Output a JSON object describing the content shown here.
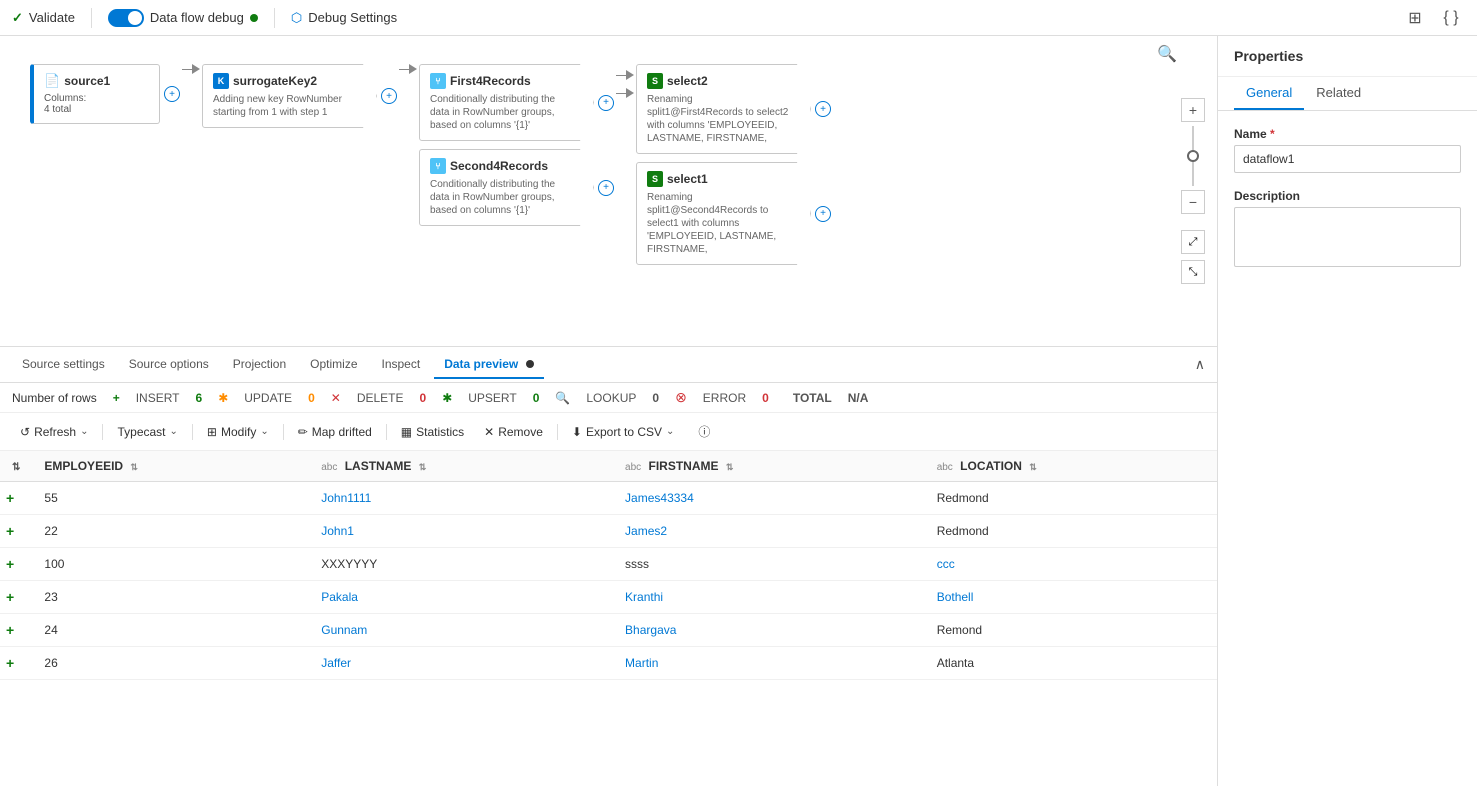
{
  "toolbar": {
    "validate_label": "Validate",
    "debug_label": "Data flow debug",
    "debug_settings_label": "Debug Settings"
  },
  "flow": {
    "nodes": [
      {
        "id": "source1",
        "title": "source1",
        "type": "source",
        "meta": "Columns:",
        "meta2": "4 total",
        "icon": "📄"
      },
      {
        "id": "surrogateKey2",
        "title": "surrogateKey2",
        "type": "transform",
        "desc": "Adding new key RowNumber starting from 1 with step 1"
      },
      {
        "id": "First4Records",
        "title": "First4Records",
        "type": "split",
        "desc": "Conditionally distributing the data in RowNumber groups, based on columns '{1}'"
      },
      {
        "id": "select2",
        "title": "select2",
        "type": "select",
        "desc": "Renaming split1@First4Records to select2 with columns 'EMPLOYEEID, LASTNAME, FIRSTNAME,"
      },
      {
        "id": "Second4Records",
        "title": "Second4Records",
        "type": "split",
        "desc": "Conditionally distributing the data in RowNumber groups, based on columns '{1}'"
      },
      {
        "id": "select1",
        "title": "select1",
        "type": "select",
        "desc": "Renaming split1@Second4Records to select1 with columns 'EMPLOYEEID, LASTNAME, FIRSTNAME,"
      }
    ]
  },
  "bottom_panel": {
    "tabs": [
      {
        "label": "Source settings",
        "active": false
      },
      {
        "label": "Source options",
        "active": false
      },
      {
        "label": "Projection",
        "active": false
      },
      {
        "label": "Optimize",
        "active": false
      },
      {
        "label": "Inspect",
        "active": false
      },
      {
        "label": "Data preview",
        "active": true
      }
    ],
    "stats": {
      "rows_label": "Number of rows",
      "insert_label": "INSERT",
      "insert_val": "6",
      "update_label": "UPDATE",
      "update_val": "0",
      "delete_label": "DELETE",
      "delete_val": "0",
      "upsert_label": "UPSERT",
      "upsert_val": "0",
      "lookup_label": "LOOKUP",
      "lookup_val": "0",
      "error_label": "ERROR",
      "error_val": "0",
      "total_label": "TOTAL",
      "total_val": "N/A"
    },
    "actions": {
      "refresh": "Refresh",
      "typecast": "Typecast",
      "modify": "Modify",
      "map_drifted": "Map drifted",
      "statistics": "Statistics",
      "remove": "Remove",
      "export_csv": "Export to CSV"
    },
    "columns": [
      {
        "name": "EMPLOYEEID",
        "type": ""
      },
      {
        "name": "LASTNAME",
        "type": "abc"
      },
      {
        "name": "FIRSTNAME",
        "type": "abc"
      },
      {
        "name": "LOCATION",
        "type": "abc"
      }
    ],
    "rows": [
      {
        "icon": "+",
        "employeeid": "55",
        "lastname": "John1111",
        "firstname": "James43334",
        "location": "Redmond"
      },
      {
        "icon": "+",
        "employeeid": "22",
        "lastname": "John1",
        "firstname": "James2",
        "location": "Redmond"
      },
      {
        "icon": "+",
        "employeeid": "100",
        "lastname": "XXXYYYY",
        "firstname": "ssss",
        "location": "ccc"
      },
      {
        "icon": "+",
        "employeeid": "23",
        "lastname": "Pakala",
        "firstname": "Kranthi",
        "location": "Bothell"
      },
      {
        "icon": "+",
        "employeeid": "24",
        "lastname": "Gunnam",
        "firstname": "Bhargava",
        "location": "Remond"
      },
      {
        "icon": "+",
        "employeeid": "26",
        "lastname": "Jaffer",
        "firstname": "Martin",
        "location": "Atlanta"
      }
    ]
  },
  "properties": {
    "title": "Properties",
    "tabs": [
      "General",
      "Related"
    ],
    "name_label": "Name",
    "name_value": "dataflow1",
    "desc_label": "Description",
    "desc_value": ""
  },
  "icons": {
    "validate_check": "✓",
    "search": "🔍",
    "code_view": "{ }",
    "grid_view": "⊞",
    "plus": "+",
    "minus": "−",
    "chevron_up": "∧",
    "chevron_down": "∨",
    "refresh_circle": "↺",
    "chevron_small": "⌄",
    "edit": "✏",
    "sort_updown": "⇅",
    "error_x": "✕",
    "warning": "⚠",
    "info": "ⓘ",
    "magnify": "⊕",
    "expand": "⤢",
    "collapse": "⤡"
  }
}
